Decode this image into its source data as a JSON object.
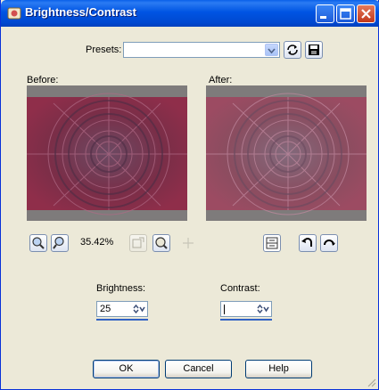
{
  "window": {
    "title": "Brightness/Contrast"
  },
  "presets": {
    "label": "Presets:",
    "value": ""
  },
  "preview": {
    "before_label": "Before:",
    "after_label": "After:",
    "zoom_text": "35.42%"
  },
  "brightness": {
    "label": "Brightness:",
    "value": "25"
  },
  "contrast": {
    "label": "Contrast:",
    "value": ""
  },
  "buttons": {
    "ok": "OK",
    "cancel": "Cancel",
    "help": "Help"
  },
  "colors": {
    "titlebar": "#0054e3",
    "dialog_bg": "#ece9d8",
    "preview_frame": "#7e7b7b",
    "image_tone_before": "#8a2e4a",
    "image_tone_after": "#8a5a68"
  },
  "icons": [
    "app-icon",
    "minimize-icon",
    "maximize-icon",
    "close-icon",
    "randomize-icon",
    "save-preset-icon",
    "zoom-in-icon",
    "zoom-out-icon",
    "zoom-100-icon",
    "navigate-icon",
    "pan-icon",
    "preview-layout-icon",
    "undo-icon",
    "reset-icon",
    "resize-grip-icon"
  ]
}
